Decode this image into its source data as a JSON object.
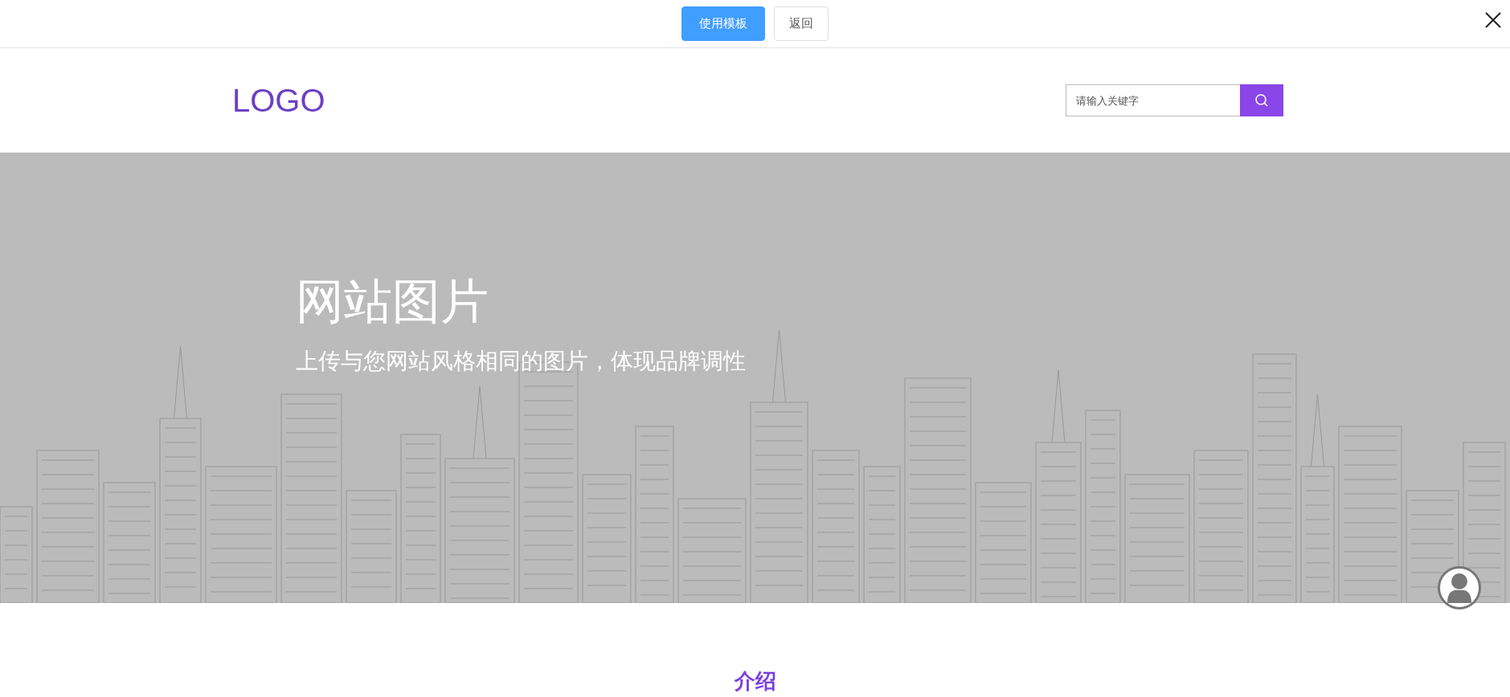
{
  "top_bar": {
    "buttons": [
      {
        "label": "使用模板",
        "kind": "primary"
      },
      {
        "label": "返回",
        "kind": "default"
      }
    ]
  },
  "header": {
    "logo": "LOGO",
    "search": {
      "placeholder": "请输入关键字"
    }
  },
  "hero": {
    "title": "网站图片",
    "subtitle": "上传与您网站风格相同的图片，体现品牌调性"
  },
  "section": {
    "title": "介绍"
  }
}
